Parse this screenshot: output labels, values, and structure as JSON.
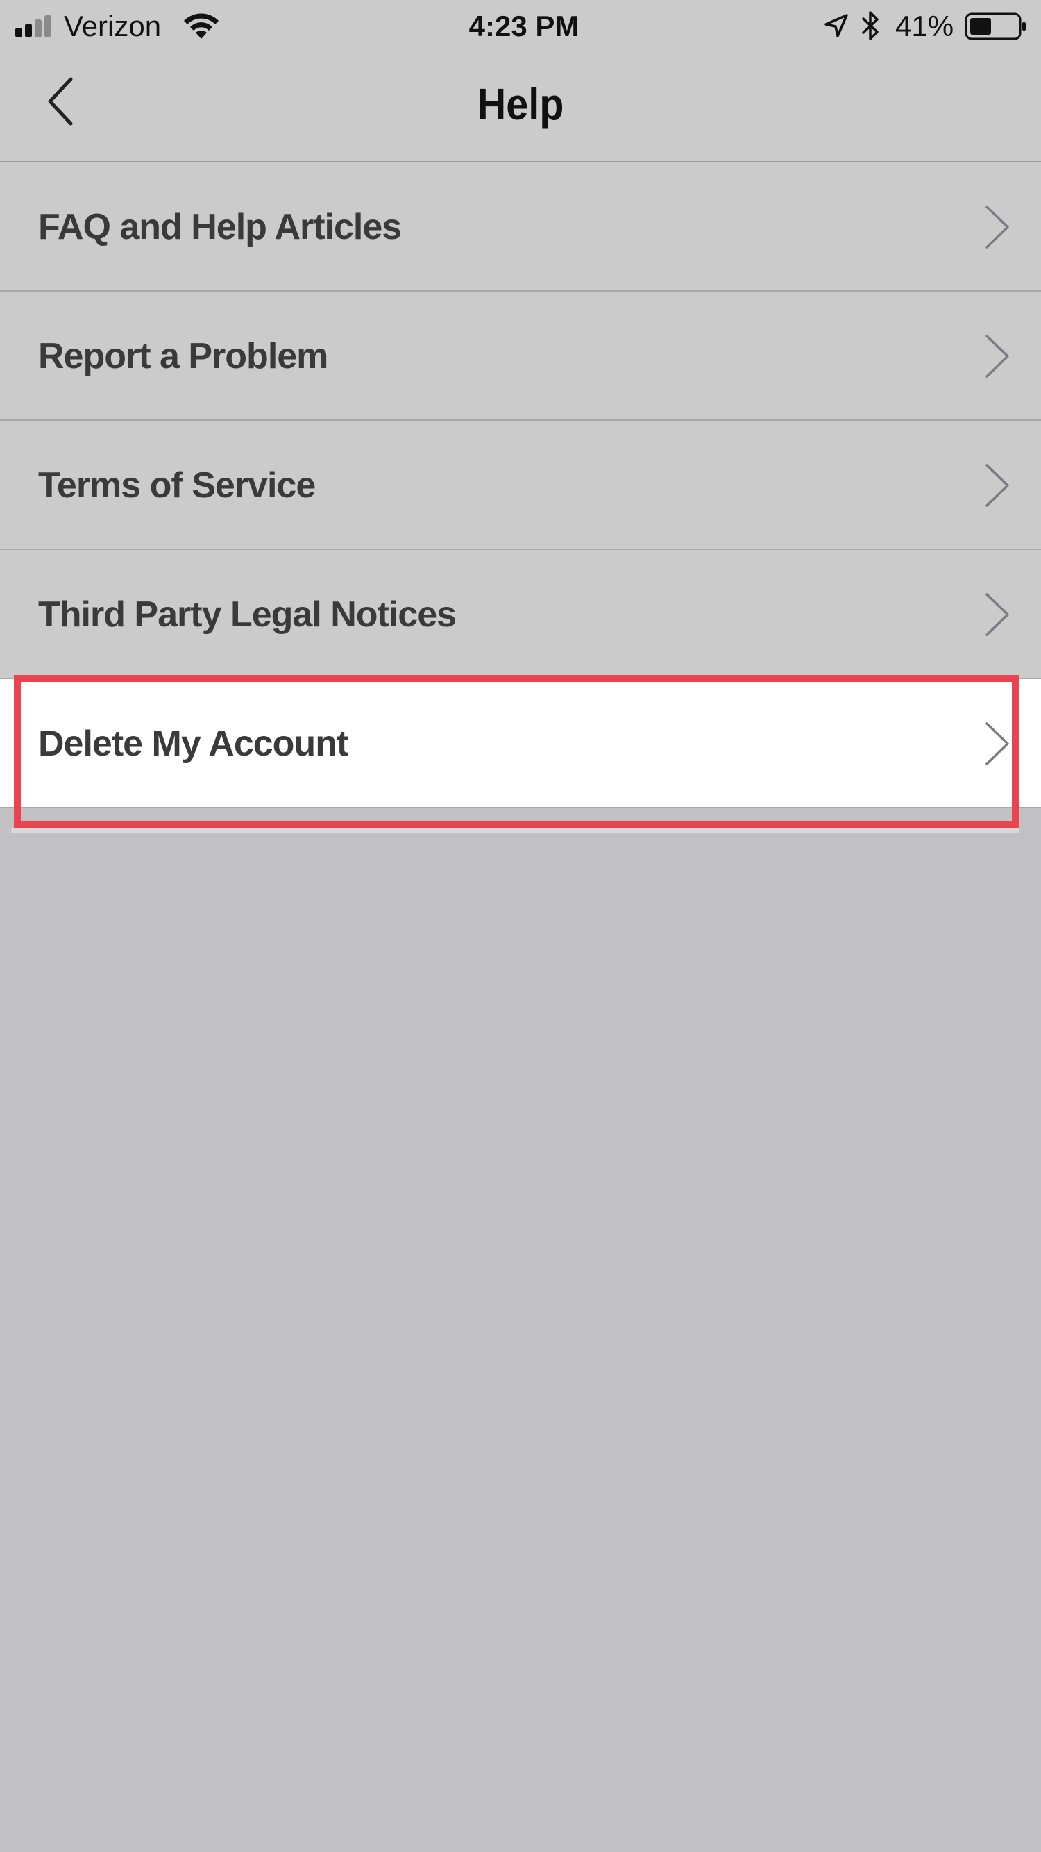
{
  "status_bar": {
    "carrier": "Verizon",
    "time": "4:23 PM",
    "battery_percent": "41%",
    "icons": [
      "signal-icon",
      "wifi-icon",
      "location-icon",
      "bluetooth-icon",
      "battery-icon"
    ]
  },
  "nav": {
    "title": "Help",
    "back_icon": "chevron-left-icon"
  },
  "menu": {
    "items": [
      {
        "label": "FAQ and Help Articles",
        "icon": "chevron-right-icon"
      },
      {
        "label": "Report a Problem",
        "icon": "chevron-right-icon"
      },
      {
        "label": "Terms of Service",
        "icon": "chevron-right-icon"
      },
      {
        "label": "Third Party Legal Notices",
        "icon": "chevron-right-icon"
      },
      {
        "label": "Delete My Account",
        "icon": "chevron-right-icon",
        "highlighted": true
      }
    ]
  },
  "colors": {
    "highlight_border": "#e9444f",
    "background": "#c1c1c3",
    "row_background": "#cbcbcb"
  }
}
